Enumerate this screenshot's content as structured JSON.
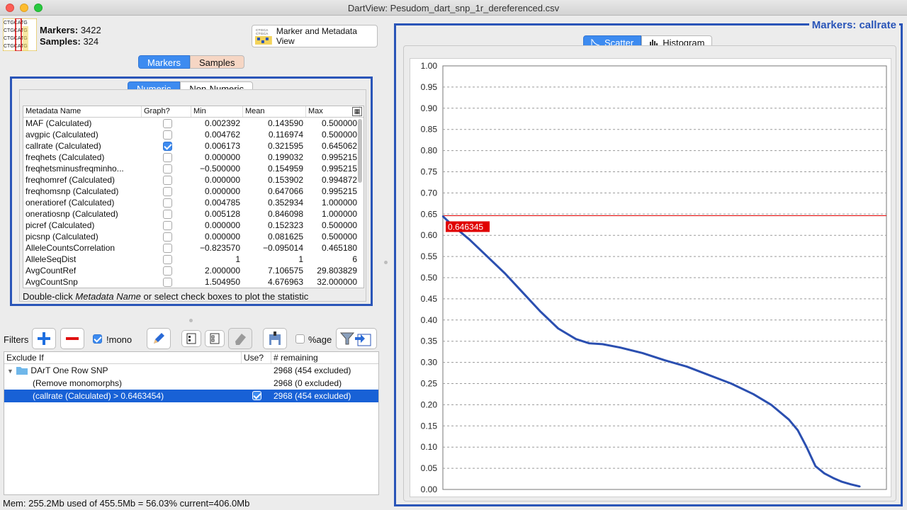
{
  "window": {
    "title": "DartView: Pesudom_dart_snp_1r_dereferenced.csv"
  },
  "header": {
    "markers_label": "Markers:",
    "markers_count": "3422",
    "samples_label": "Samples:",
    "samples_count": "324",
    "view_button_label": "Marker and Metadata View"
  },
  "tabs": {
    "markers": "Markers",
    "samples": "Samples",
    "active": "Markers"
  },
  "subtabs": {
    "numeric": "Numeric",
    "non_numeric": "Non-Numeric",
    "active": "Numeric"
  },
  "metadata_table": {
    "columns": {
      "name": "Metadata Name",
      "graph": "Graph?",
      "min": "Min",
      "mean": "Mean",
      "max": "Max"
    },
    "rows": [
      {
        "name": "MAF (Calculated)",
        "graph": false,
        "min": "0.002392",
        "mean": "0.143590",
        "max": "0.500000"
      },
      {
        "name": "avgpic (Calculated)",
        "graph": false,
        "min": "0.004762",
        "mean": "0.116974",
        "max": "0.500000"
      },
      {
        "name": "callrate (Calculated)",
        "graph": true,
        "min": "0.006173",
        "mean": "0.321595",
        "max": "0.645062"
      },
      {
        "name": "freqhets (Calculated)",
        "graph": false,
        "min": "0.000000",
        "mean": "0.199032",
        "max": "0.995215"
      },
      {
        "name": "freqhetsminusfreqminho...",
        "graph": false,
        "min": "−0.500000",
        "mean": "0.154959",
        "max": "0.995215"
      },
      {
        "name": "freqhomref (Calculated)",
        "graph": false,
        "min": "0.000000",
        "mean": "0.153902",
        "max": "0.994872"
      },
      {
        "name": "freqhomsnp (Calculated)",
        "graph": false,
        "min": "0.000000",
        "mean": "0.647066",
        "max": "0.995215"
      },
      {
        "name": "oneratioref (Calculated)",
        "graph": false,
        "min": "0.004785",
        "mean": "0.352934",
        "max": "1.000000"
      },
      {
        "name": "oneratiosnp (Calculated)",
        "graph": false,
        "min": "0.005128",
        "mean": "0.846098",
        "max": "1.000000"
      },
      {
        "name": "picref (Calculated)",
        "graph": false,
        "min": "0.000000",
        "mean": "0.152323",
        "max": "0.500000"
      },
      {
        "name": "picsnp (Calculated)",
        "graph": false,
        "min": "0.000000",
        "mean": "0.081625",
        "max": "0.500000"
      },
      {
        "name": "AlleleCountsCorrelation",
        "graph": false,
        "min": "−0.823570",
        "mean": "−0.095014",
        "max": "0.465180"
      },
      {
        "name": "AlleleSeqDist",
        "graph": false,
        "min": "1",
        "mean": "1",
        "max": "6"
      },
      {
        "name": "AvgCountRef",
        "graph": false,
        "min": "2.000000",
        "mean": "7.106575",
        "max": "29.803829"
      },
      {
        "name": "AvgCountSnp",
        "graph": false,
        "min": "1.504950",
        "mean": "4.676963",
        "max": "32.000000"
      }
    ],
    "hint_before": "Double-click ",
    "hint_em": "Metadata Name",
    "hint_after": " or select check boxes to plot the statistic"
  },
  "filters": {
    "label": "Filters",
    "mono_label": "!mono",
    "mono_checked": true,
    "pct_label": "%age",
    "pct_checked": false,
    "columns": {
      "exclude_if": "Exclude If",
      "use": "Use?",
      "remaining": "# remaining"
    },
    "rows": [
      {
        "name": "DArT One Row SNP",
        "use": null,
        "remaining": "2968 (454 excluded)",
        "kind": "folder"
      },
      {
        "name": "(Remove monomorphs)",
        "use": null,
        "remaining": "2968 (0 excluded)",
        "kind": "item"
      },
      {
        "name": "(callrate (Calculated) > 0.6463454)",
        "use": true,
        "remaining": "2968 (454 excluded)",
        "kind": "selected"
      }
    ]
  },
  "status_bar": "Mem: 255.2Mb used of 455.5Mb = 56.03% current=406.0Mb",
  "right_panel": {
    "title": "Markers: callrate",
    "tab_scatter": "Scatter",
    "tab_histogram": "Histogram",
    "active_tab": "Scatter",
    "threshold_label": "0.646345"
  },
  "colors": {
    "accent": "#2a55b8",
    "series": "#2b4fb0",
    "threshold": "#e00000",
    "selection": "#1861d6"
  },
  "chart_data": {
    "type": "scatter",
    "title": "",
    "xlabel": "",
    "ylabel": "",
    "ylim": [
      0,
      1.0
    ],
    "yticks": [
      "0.00",
      "0.05",
      "0.10",
      "0.15",
      "0.20",
      "0.25",
      "0.30",
      "0.35",
      "0.40",
      "0.45",
      "0.50",
      "0.55",
      "0.60",
      "0.65",
      "0.70",
      "0.75",
      "0.80",
      "0.85",
      "0.90",
      "0.95",
      "1.00"
    ],
    "x_fraction": [
      0.0,
      0.02,
      0.06,
      0.1,
      0.14,
      0.18,
      0.22,
      0.26,
      0.3,
      0.33,
      0.36,
      0.4,
      0.45,
      0.5,
      0.55,
      0.6,
      0.65,
      0.7,
      0.74,
      0.78,
      0.8,
      0.82,
      0.84,
      0.86,
      0.88,
      0.9,
      0.92,
      0.94
    ],
    "y": [
      0.645,
      0.625,
      0.59,
      0.55,
      0.51,
      0.465,
      0.42,
      0.38,
      0.355,
      0.345,
      0.343,
      0.335,
      0.322,
      0.305,
      0.29,
      0.27,
      0.25,
      0.225,
      0.2,
      0.165,
      0.14,
      0.1,
      0.055,
      0.038,
      0.027,
      0.018,
      0.012,
      0.007
    ],
    "threshold": 0.646345
  }
}
